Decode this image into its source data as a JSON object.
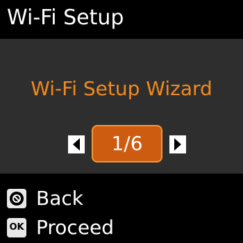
{
  "header": {
    "title": "Wi-Fi Setup"
  },
  "menu": {
    "item_title": "Wi-Fi Setup Wizard",
    "page_indicator": "1/6",
    "prev_icon": "left-triangle-icon",
    "next_icon": "right-triangle-icon"
  },
  "footer": {
    "back": {
      "icon": "stop-back-icon",
      "label": "Back"
    },
    "proceed": {
      "icon_text": "OK",
      "label": "Proceed"
    }
  },
  "colors": {
    "accent_text": "#f28a1d",
    "page_box_fill": "#cd5b10",
    "page_box_border": "#f39a3b",
    "panel_background": "#2e2e2e"
  }
}
